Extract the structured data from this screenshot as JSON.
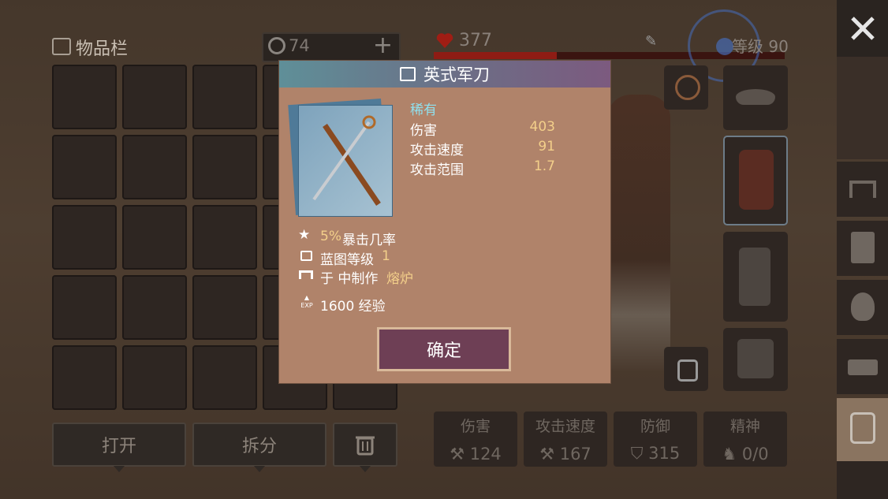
{
  "inventory": {
    "title": "物品栏",
    "currency_value": "74",
    "add_label": "+",
    "open_label": "打开",
    "split_label": "拆分"
  },
  "status": {
    "health": "377",
    "level_label": "等级 90"
  },
  "stats": [
    {
      "label": "伤害",
      "value": "124"
    },
    {
      "label": "攻击速度",
      "value": "167"
    },
    {
      "label": "防御",
      "value": "315"
    },
    {
      "label": "精神",
      "value": "0/0"
    }
  ],
  "item": {
    "name": "英式军刀",
    "rarity": "稀有",
    "attributes": [
      {
        "label": "伤害",
        "value": "403"
      },
      {
        "label": "攻击速度",
        "value": "91"
      },
      {
        "label": "攻击范围",
        "value": "1.7"
      }
    ],
    "crit_value": "5%",
    "crit_label": "暴击几率",
    "blueprint_label": "蓝图等级",
    "blueprint_value": "1",
    "craft_label": "于 中制作",
    "craft_station": "熔炉",
    "exp_icon_text": "EXP",
    "exp_text": "1600 经验",
    "confirm_label": "确定"
  },
  "colors": {
    "accent_value": "#f3cf8a",
    "rarity": "#8fe0ee",
    "modal_bg": "#b0836a"
  }
}
